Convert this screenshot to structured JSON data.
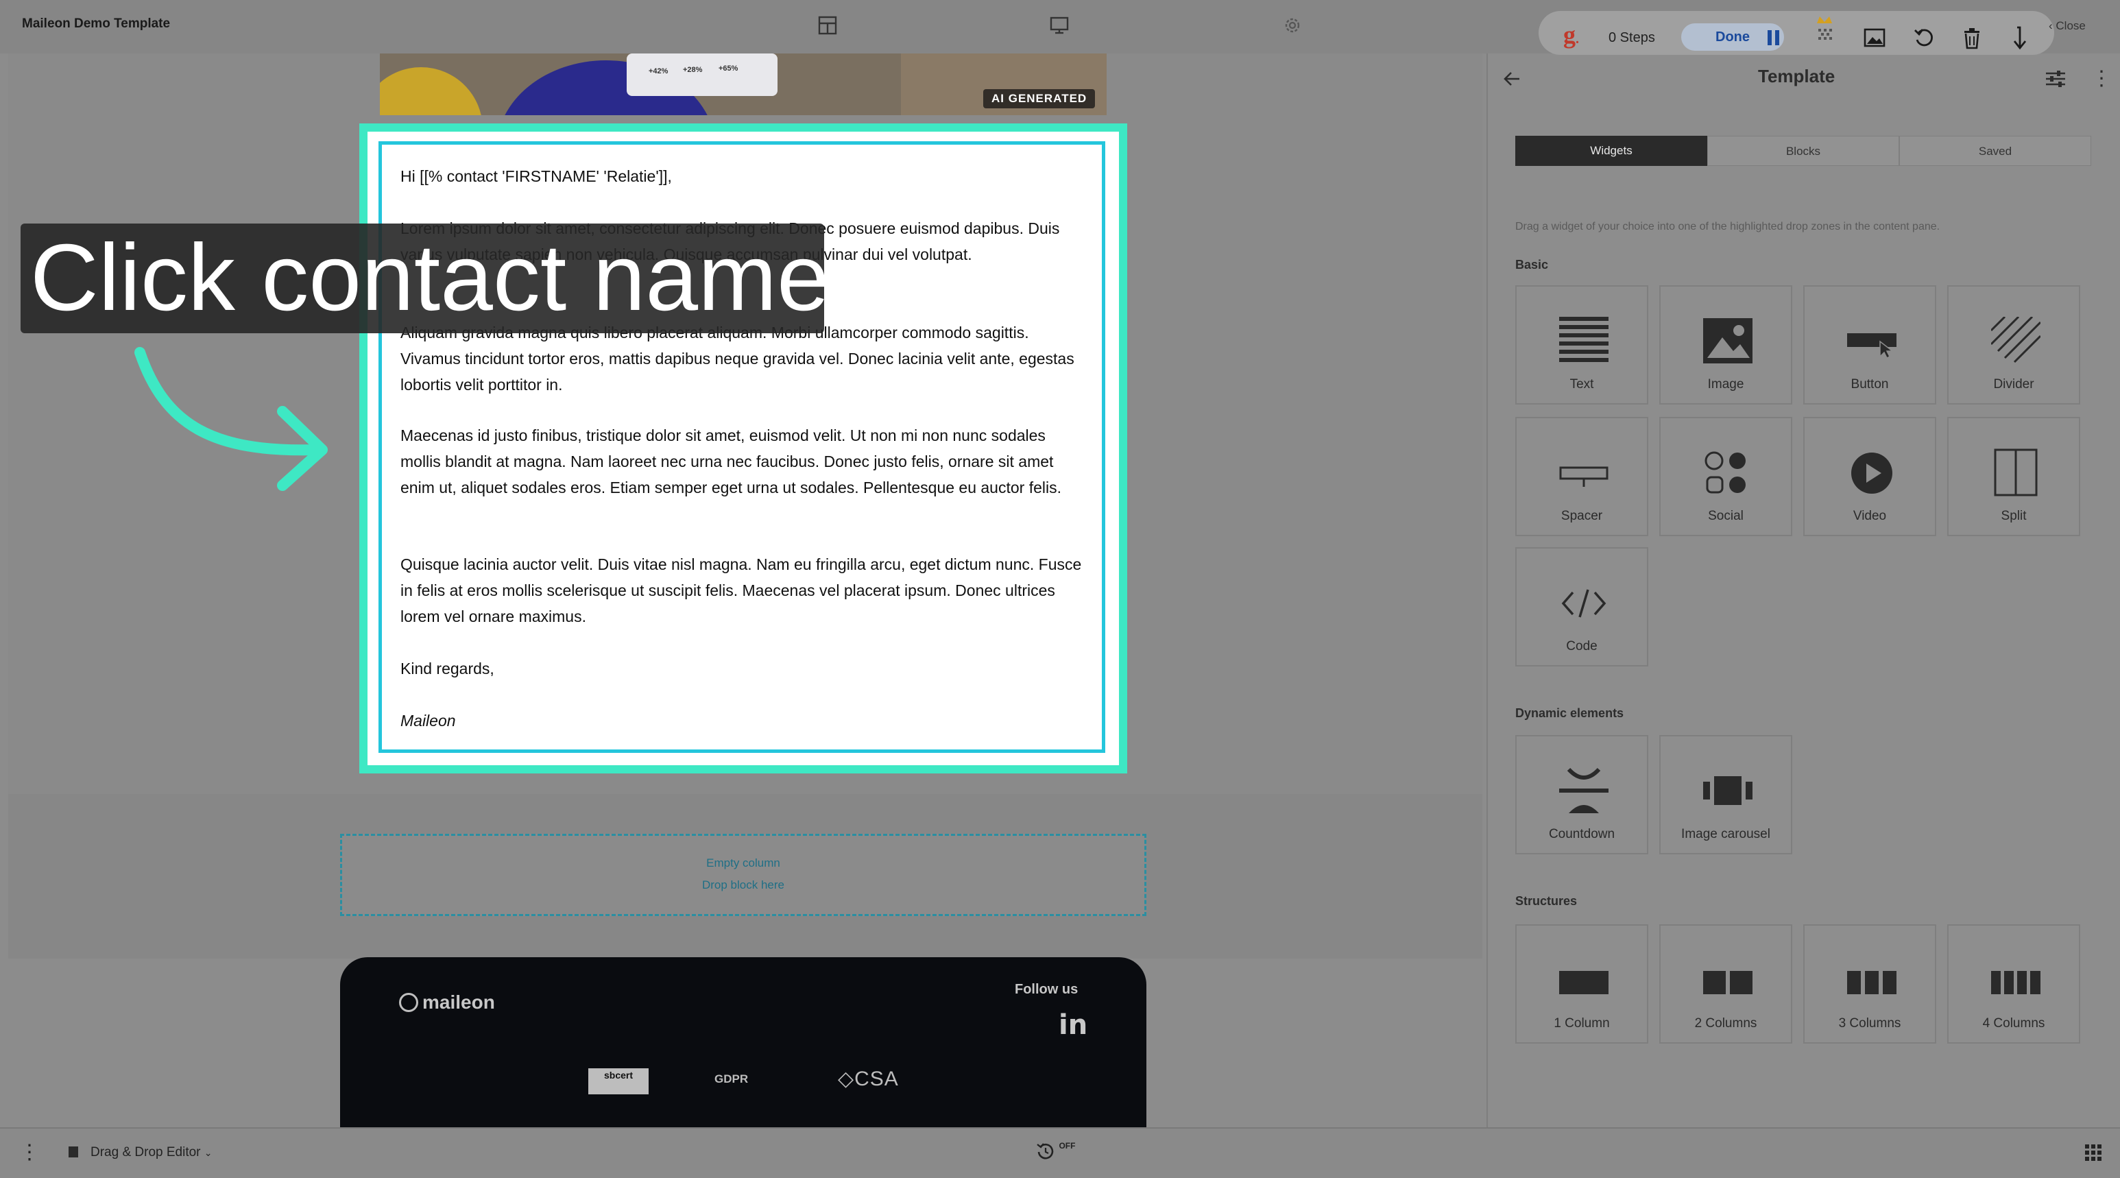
{
  "app_title": "Maileon Demo Template",
  "hero_badge": "AI GENERATED",
  "hero_stats": [
    "+42%",
    "+28%",
    "+65%"
  ],
  "email": {
    "greeting": "Hi [[% contact 'FIRSTNAME' 'Relatie']],",
    "p1": "Lorem ipsum dolor sit amet, consectetur adipiscing elit. Donec posuere euismod dapibus. Duis varius vulputate sapien non vehicula. Quisque accumsan pulvinar dui vel volutpat.",
    "p2": "Aliquam gravida magna quis libero placerat aliquam. Morbi ullamcorper commodo sagittis. Vivamus tincidunt tortor eros, mattis dapibus neque gravida vel. Donec lacinia velit ante, egestas lobortis velit porttitor in.",
    "p3": "Maecenas id justo finibus, tristique dolor sit amet, euismod velit. Ut non mi non nunc sodales mollis blandit at magna. Nam laoreet nec urna nec faucibus. Donec justo felis, ornare sit amet enim ut, aliquet sodales eros. Etiam semper eget urna ut sodales. Pellentesque eu auctor felis.",
    "p4": "Quisque lacinia auctor velit. Duis vitae nisl magna. Nam eu fringilla arcu, eget dictum nunc. Fusce in felis at eros mollis scelerisque ut suscipit felis. Maecenas vel placerat ipsum. Donec ultrices lorem vel ornare maximus.",
    "closing": "Kind regards,",
    "signature": "Maileon"
  },
  "dropzone": {
    "line1": "Empty column",
    "line2": "Drop block here"
  },
  "footer": {
    "brand": "maileon",
    "follow": "Follow us",
    "badges": [
      "sbcert",
      "GDPR",
      "CSA"
    ]
  },
  "guide": {
    "text": "Click contact name"
  },
  "recorder": {
    "steps": "0 Steps",
    "done": "Done",
    "close": "Close"
  },
  "panel": {
    "title": "Template",
    "tabs": [
      "Widgets",
      "Blocks",
      "Saved"
    ],
    "help": "Drag a widget of your choice into one of the highlighted drop zones in the content pane.",
    "basic_title": "Basic",
    "basic": [
      "Text",
      "Image",
      "Button",
      "Divider",
      "Spacer",
      "Social",
      "Video",
      "Split",
      "Code"
    ],
    "dynamic_title": "Dynamic elements",
    "dynamic": [
      "Countdown",
      "Image carousel"
    ],
    "structures_title": "Structures",
    "structures": [
      "1 Column",
      "2 Columns",
      "3 Columns",
      "4 Columns"
    ]
  },
  "bottombar": {
    "editor_label": "Drag & Drop Editor",
    "autosave": "OFF"
  },
  "colors": {
    "highlight": "#3ee8c4",
    "selection_border": "#24c6dc",
    "footer_bg": "#0a0c10"
  }
}
